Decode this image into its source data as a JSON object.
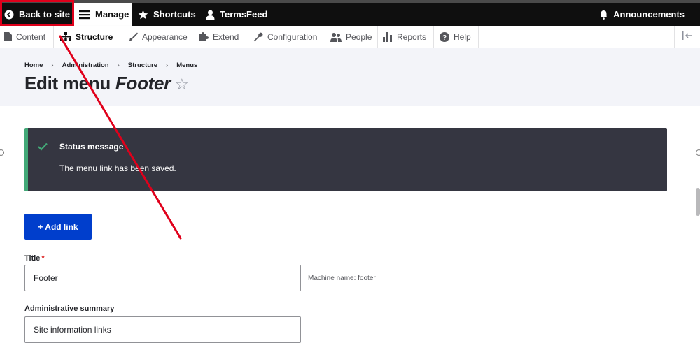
{
  "toolbar": {
    "back_label": "Back to site",
    "manage_label": "Manage",
    "shortcuts_label": "Shortcuts",
    "user_label": "TermsFeed",
    "announcements_label": "Announcements"
  },
  "tray": {
    "items": [
      {
        "label": "Content",
        "icon": "file-icon"
      },
      {
        "label": "Structure",
        "icon": "sitemap-icon",
        "active": true
      },
      {
        "label": "Appearance",
        "icon": "paintbrush-icon"
      },
      {
        "label": "Extend",
        "icon": "puzzle-icon"
      },
      {
        "label": "Configuration",
        "icon": "wrench-icon"
      },
      {
        "label": "People",
        "icon": "people-icon"
      },
      {
        "label": "Reports",
        "icon": "bar-chart-icon"
      },
      {
        "label": "Help",
        "icon": "help-icon"
      }
    ]
  },
  "breadcrumb": [
    "Home",
    "Administration",
    "Structure",
    "Menus"
  ],
  "page": {
    "title_prefix": "Edit menu",
    "title_menu": "Footer",
    "star": "☆"
  },
  "status": {
    "title": "Status message",
    "message": "The menu link has been saved."
  },
  "actions": {
    "add_link": "+ Add link"
  },
  "form": {
    "title_label": "Title",
    "required_marker": "*",
    "title_value": "Footer",
    "machine_name": "Machine name: footer",
    "summary_label": "Administrative summary",
    "summary_value": "Site information links"
  },
  "colors": {
    "toolbar_bg": "#0f0f0f",
    "accent_button": "#003ecc",
    "status_bg": "#353641",
    "status_ok": "#42a877",
    "annotation_red": "#e0001b"
  }
}
